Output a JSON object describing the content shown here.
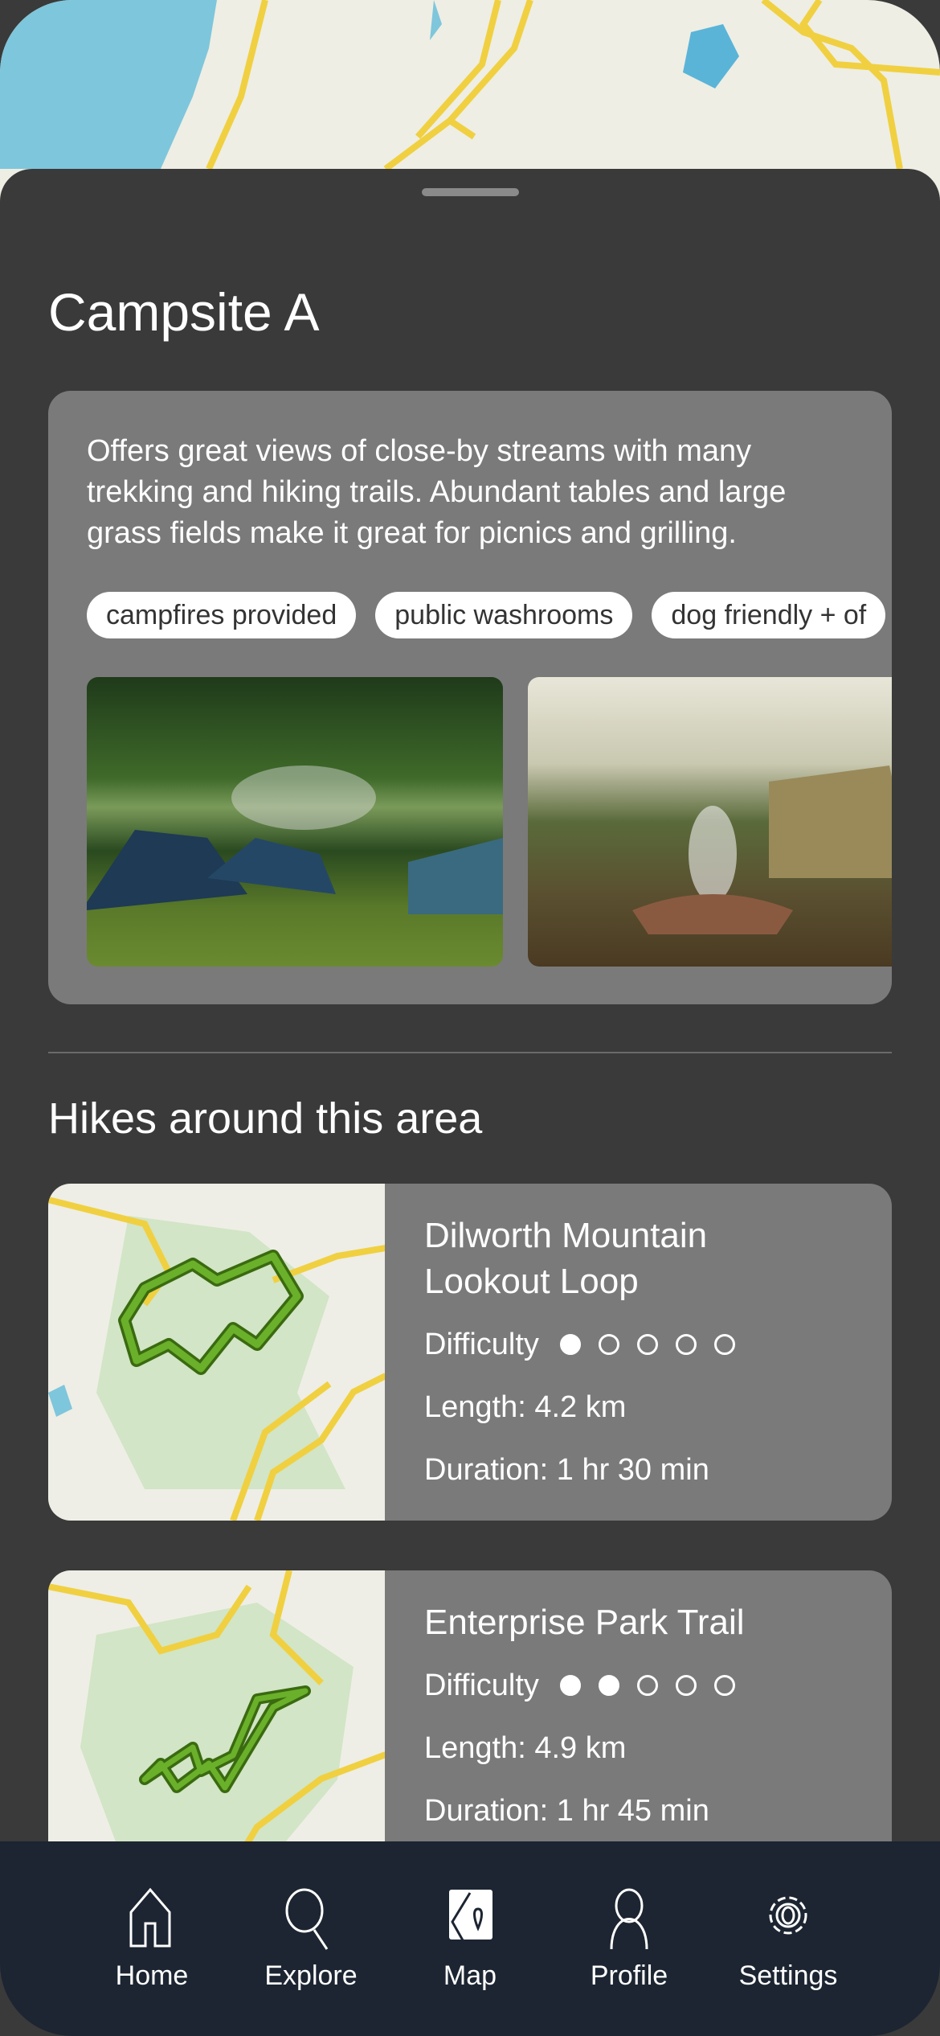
{
  "campsite": {
    "title": "Campsite A",
    "description": "Offers great views of close-by streams with many trekking and hiking trails. Abundant tables and large grass fields make it great for picnics and grilling.",
    "tags": [
      "campfires provided",
      "public washrooms",
      "dog friendly + of"
    ]
  },
  "hikes_section": {
    "title": "Hikes around this area",
    "difficulty_label": "Difficulty",
    "hikes": [
      {
        "name": "Dilworth Mountain Lookout Loop",
        "difficulty": 1,
        "length": "Length: 4.2 km",
        "duration": "Duration: 1 hr 30 min"
      },
      {
        "name": "Enterprise Park Trail",
        "difficulty": 2,
        "length": "Length: 4.9 km",
        "duration": "Duration: 1 hr 45 min"
      }
    ]
  },
  "nav": {
    "items": [
      {
        "label": "Home",
        "icon": "home-icon"
      },
      {
        "label": "Explore",
        "icon": "search-icon"
      },
      {
        "label": "Map",
        "icon": "map-icon",
        "active": true
      },
      {
        "label": "Profile",
        "icon": "person-icon"
      },
      {
        "label": "Settings",
        "icon": "gear-icon"
      }
    ]
  },
  "colors": {
    "sheet": "#3a3a3a",
    "card": "#7a7a7a",
    "nav": "#1c2531",
    "trail": "#5a9a1a",
    "road": "#f0d040",
    "water": "#7ec6dc"
  }
}
